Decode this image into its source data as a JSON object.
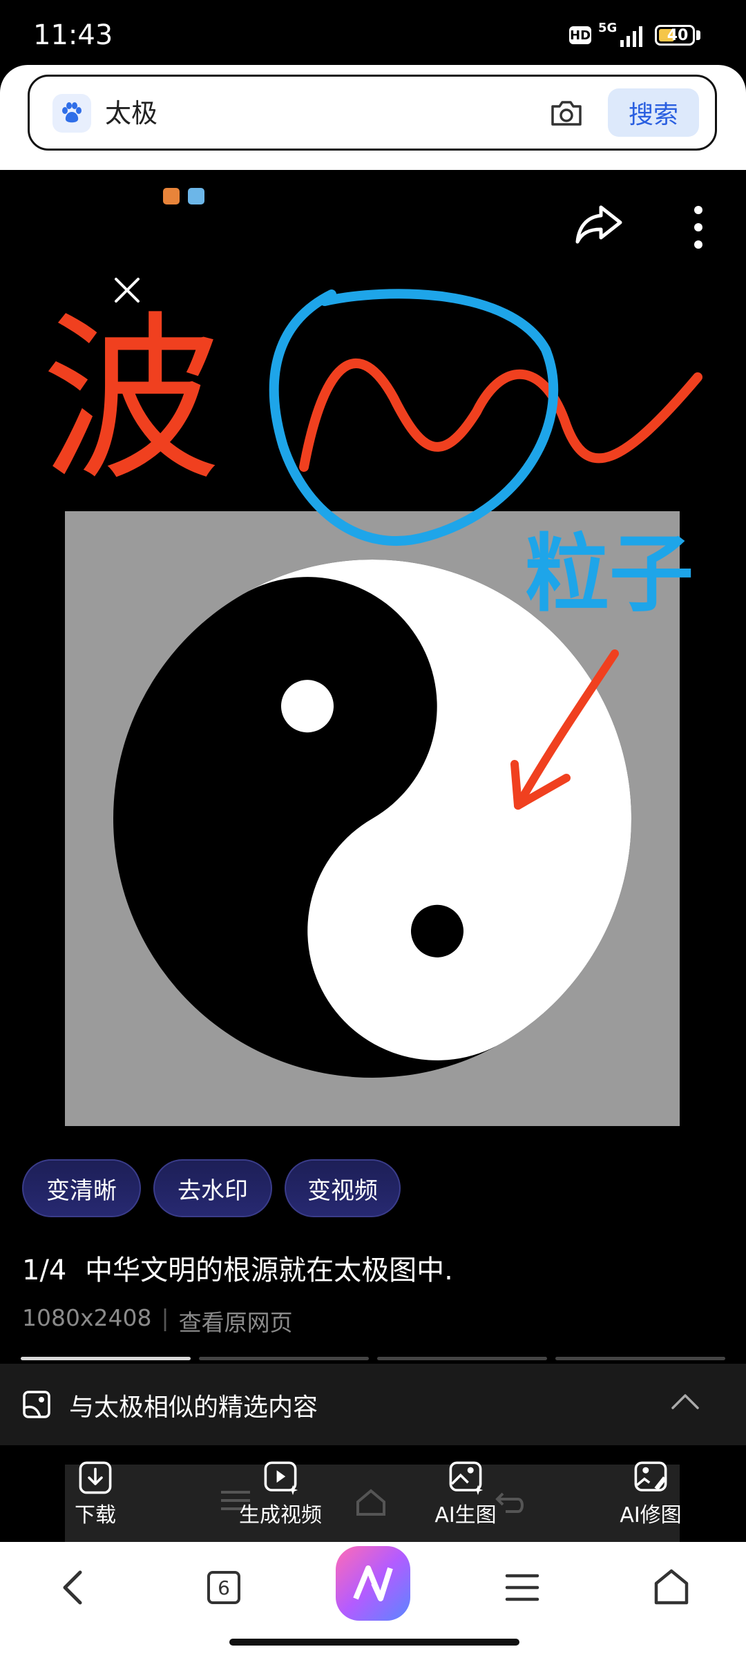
{
  "status_bar": {
    "time": "11:43",
    "hd": "HD",
    "network": "5G",
    "battery": "40"
  },
  "search": {
    "query": "太极",
    "button_label": "搜索"
  },
  "annotations": {
    "wave_text": "波",
    "particle_text": "粒子"
  },
  "chips": [
    "变清晰",
    "去水印",
    "变视频"
  ],
  "caption": {
    "index": "1/4",
    "title": "中华文明的根源就在太极图中."
  },
  "image_meta": {
    "resolution": "1080x2408",
    "source_link": "查看原网页"
  },
  "similar": {
    "label": "与太极相似的精选内容"
  },
  "actions": {
    "download": "下载",
    "make_video": "生成视频",
    "ai_image": "AI生图",
    "ai_edit": "AI修图"
  },
  "nav": {
    "tab_count": "6"
  },
  "pager": {
    "current": 1,
    "total": 4
  }
}
